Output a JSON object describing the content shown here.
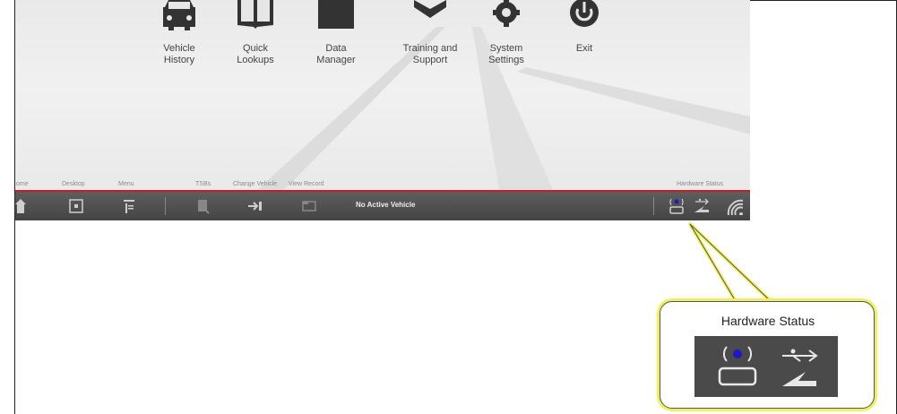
{
  "launchers": [
    {
      "label": "Vehicle\nHistory",
      "icon": "car-icon"
    },
    {
      "label": "Quick\nLookups",
      "icon": "book-icon"
    },
    {
      "label": "Data\nManager",
      "icon": "folder-icon"
    },
    {
      "label": "Training and\nSupport",
      "icon": "graduation-cap-icon"
    },
    {
      "label": "System\nSettings",
      "icon": "gear-icon"
    },
    {
      "label": "Exit",
      "icon": "power-icon"
    }
  ],
  "toolbar": {
    "labels": {
      "home": "ome",
      "desktop": "Desktop",
      "menu": "Menu",
      "tsbs": "TSBs",
      "change_vehicle": "Change Vehicle",
      "view_record": "View Record",
      "hardware_status": "Hardware Status"
    },
    "vehicle_status": "No Active Vehicle"
  },
  "callout": {
    "title": "Hardware Status"
  },
  "colors": {
    "accent_red": "#c42020",
    "callout_glow": "#f0f05a",
    "vci_dot": "#1a1acc"
  }
}
